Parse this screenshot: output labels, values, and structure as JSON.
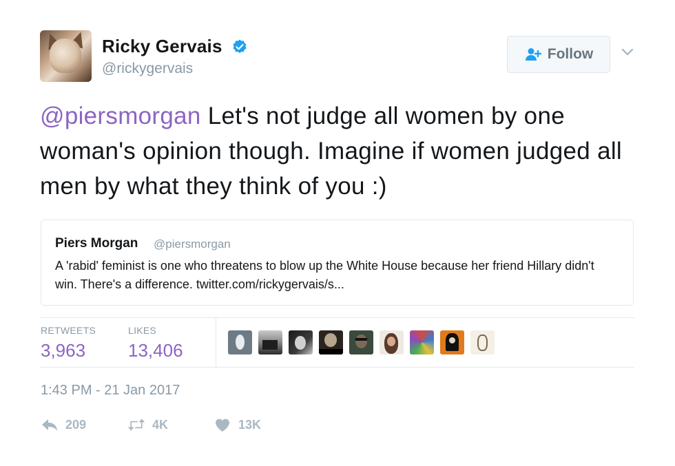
{
  "author": {
    "display_name": "Ricky Gervais",
    "handle": "@rickygervais",
    "verified": true,
    "avatar_icon": "cat-avatar"
  },
  "follow_button": {
    "label": "Follow",
    "icon": "add-user-icon"
  },
  "caret_icon": "chevron-down-icon",
  "tweet": {
    "mention": "@piersmorgan",
    "text": " Let's not judge all women by one woman's opinion though. Imagine if women judged all men by what they think of you :)"
  },
  "quoted_tweet": {
    "name": "Piers Morgan",
    "handle": "@piersmorgan",
    "text": "A 'rabid' feminist is one who threatens to blow up the White House because her friend Hillary didn't win. There's a difference. twitter.com/rickygervais/s..."
  },
  "stats": {
    "retweets_label": "RETWEETS",
    "retweets_value": "3,963",
    "likes_label": "LIKES",
    "likes_value": "13,406"
  },
  "likers": [
    {
      "name": "liker-avatar-1"
    },
    {
      "name": "liker-avatar-2"
    },
    {
      "name": "liker-avatar-3"
    },
    {
      "name": "liker-avatar-4"
    },
    {
      "name": "liker-avatar-5"
    },
    {
      "name": "liker-avatar-6"
    },
    {
      "name": "liker-avatar-7"
    },
    {
      "name": "liker-avatar-8"
    },
    {
      "name": "liker-avatar-9"
    }
  ],
  "timestamp": "1:43 PM - 21 Jan 2017",
  "actions": {
    "reply_count": "209",
    "retweet_count": "4K",
    "like_count": "13K"
  },
  "colors": {
    "mention": "#8c64c4",
    "muted": "#8899a6",
    "verified": "#1da1f2"
  }
}
